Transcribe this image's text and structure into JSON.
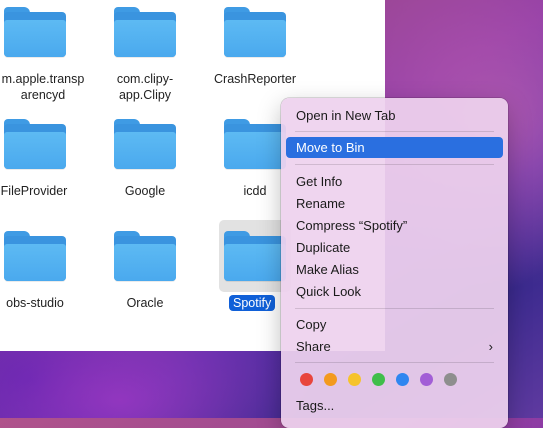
{
  "finder": {
    "items": [
      {
        "name": "m.apple.transp\narencyd"
      },
      {
        "name": "com.clipy-\napp.Clipy"
      },
      {
        "name": "CrashReporter"
      },
      {
        "name": "FileProvider"
      },
      {
        "name": "Google"
      },
      {
        "name": "icdd"
      },
      {
        "name": "obs-studio"
      },
      {
        "name": "Oracle"
      },
      {
        "name": "Spotify"
      }
    ],
    "item1_line1": "m.apple.transp",
    "item1_line2": "arencyd",
    "item2_line1": "com.clipy-",
    "item2_line2": "app.Clipy"
  },
  "context_menu": {
    "open_new_tab": "Open in New Tab",
    "move_to_bin": "Move to Bin",
    "get_info": "Get Info",
    "rename": "Rename",
    "compress": "Compress “Spotify”",
    "duplicate": "Duplicate",
    "make_alias": "Make Alias",
    "quick_look": "Quick Look",
    "copy": "Copy",
    "share": "Share",
    "tags": "Tags...",
    "tag_colors": [
      "#e8453c",
      "#f39a1e",
      "#f6c32b",
      "#3fbe4a",
      "#2f86f0",
      "#a25ed6",
      "#8e8e8e"
    ]
  },
  "icons": {
    "folder": "folder-icon",
    "chevron": "chevron-right-icon"
  }
}
